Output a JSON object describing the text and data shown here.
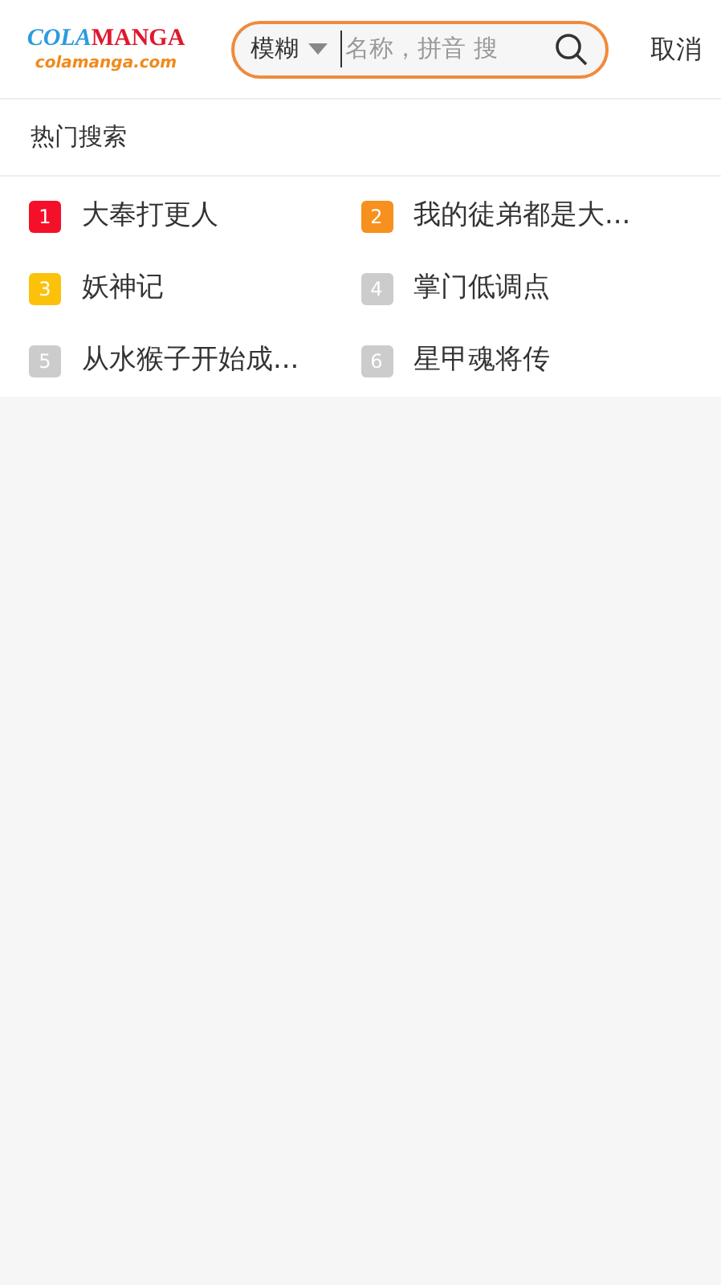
{
  "header": {
    "logo": {
      "part_1": "COLA",
      "part_2": "MANGA",
      "domain": "colamanga.com"
    },
    "search": {
      "mode": "模糊",
      "placeholder": "名称，拼音 搜"
    },
    "cancel": "取消"
  },
  "hot_search": {
    "title": "热门搜索",
    "items": [
      {
        "rank": "1",
        "title": "大奉打更人",
        "color": "#f5102a"
      },
      {
        "rank": "2",
        "title": "我的徒弟都是大...",
        "color": "#f7901e"
      },
      {
        "rank": "3",
        "title": "妖神记",
        "color": "#fcc10a"
      },
      {
        "rank": "4",
        "title": "掌门低调点",
        "color": "#cccccc"
      },
      {
        "rank": "5",
        "title": "从水猴子开始成...",
        "color": "#cccccc"
      },
      {
        "rank": "6",
        "title": "星甲魂将传",
        "color": "#cccccc"
      }
    ]
  }
}
